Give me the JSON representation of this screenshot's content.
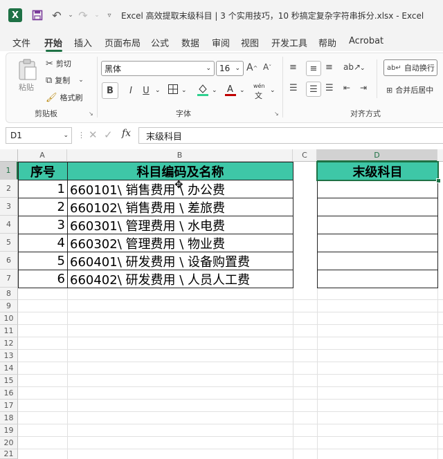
{
  "window": {
    "title": "Excel 高效提取末级科目 | 3 个实用技巧，10 秒搞定复杂字符串拆分.xlsx  -  Excel"
  },
  "tabs": [
    "文件",
    "开始",
    "插入",
    "页面布局",
    "公式",
    "数据",
    "审阅",
    "视图",
    "开发工具",
    "帮助",
    "Acrobat"
  ],
  "ribbon": {
    "clipboard": {
      "paste": "粘贴",
      "cut": "剪切",
      "copy": "复制",
      "format_painter": "格式刷",
      "group": "剪贴板"
    },
    "font": {
      "name": "黑体",
      "size": "16",
      "bold": "B",
      "italic": "I",
      "underline": "U",
      "phonetic": "wén",
      "group": "字体"
    },
    "alignment": {
      "wrap": "自动换行",
      "merge": "合并后居中",
      "group": "对齐方式"
    }
  },
  "formula_bar": {
    "name_box": "D1",
    "content": "末级科目"
  },
  "columns": [
    "A",
    "B",
    "C",
    "D"
  ],
  "rows": [
    "1",
    "2",
    "3",
    "4",
    "5",
    "6",
    "7",
    "8",
    "9",
    "10",
    "11",
    "12",
    "13",
    "14",
    "15",
    "16",
    "17",
    "18",
    "19",
    "20",
    "21"
  ],
  "table": {
    "headers": [
      "序号",
      "科目编码及名称"
    ],
    "rows": [
      [
        "1",
        "660101\\ 销售费用 \\ 办公费"
      ],
      [
        "2",
        "660102\\ 销售费用 \\ 差旅费"
      ],
      [
        "3",
        "660301\\ 管理费用 \\ 水电费"
      ],
      [
        "4",
        "660302\\ 管理费用 \\ 物业费"
      ],
      [
        "5",
        "660401\\ 研发费用 \\ 设备购置费"
      ],
      [
        "6",
        "660402\\ 研发费用 \\ 人员人工费"
      ]
    ]
  },
  "result": {
    "header": "末级科目"
  },
  "colors": {
    "header_fill": "#3ec7a7",
    "accent": "#1e7145",
    "font_color": "#c00000",
    "fill_color": "#2fd08f"
  }
}
